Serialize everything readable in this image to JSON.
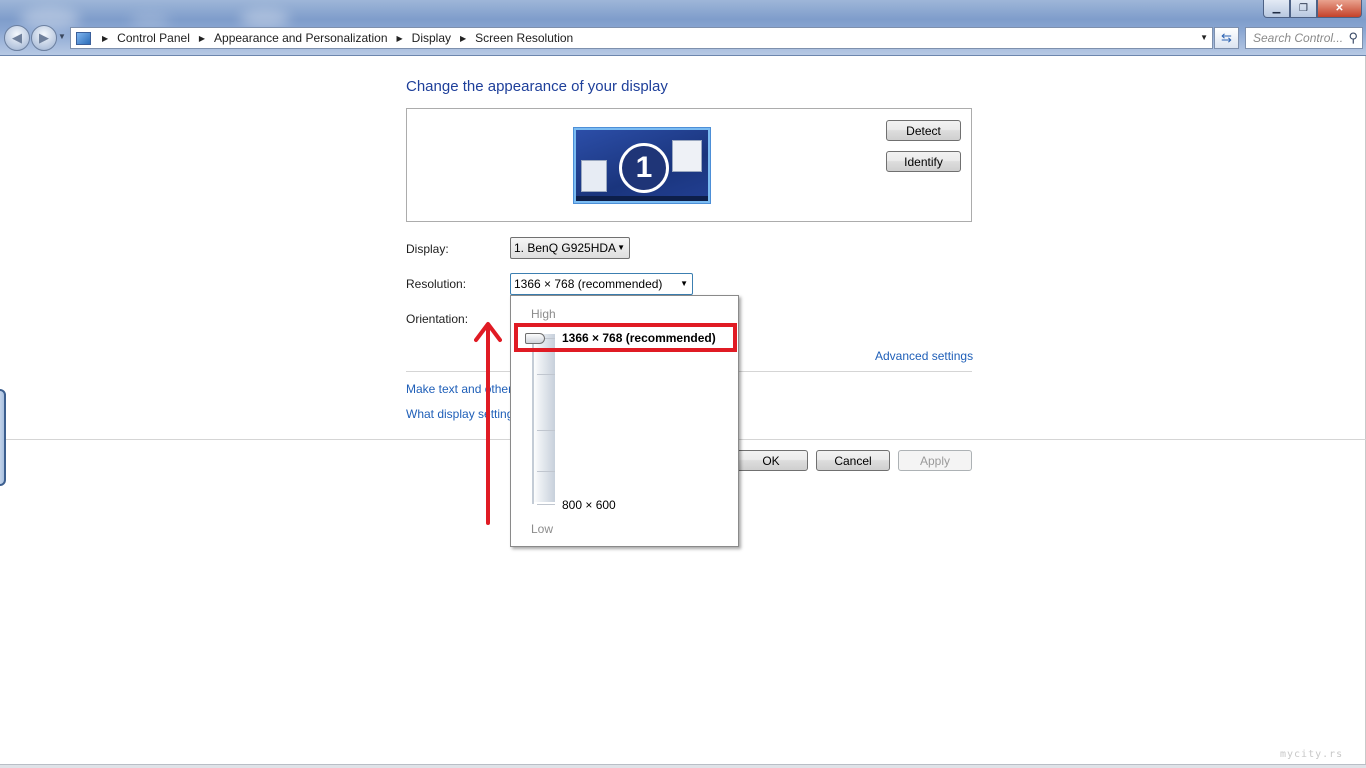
{
  "window": {
    "minimize_icon": "minimize-icon",
    "maximize_icon": "restore-icon",
    "close_icon": "close-icon"
  },
  "navigation": {
    "back_icon": "back-arrow-icon",
    "forward_icon": "forward-arrow-icon"
  },
  "address_bar": {
    "breadcrumbs": [
      "Control Panel",
      "Appearance and Personalization",
      "Display",
      "Screen Resolution"
    ]
  },
  "search": {
    "placeholder": "Search Control..."
  },
  "main": {
    "title": "Change the appearance of your display",
    "monitor_number": "1",
    "detect_label": "Detect",
    "identify_label": "Identify",
    "display_label": "Display:",
    "display_value": "1. BenQ G925HDA",
    "resolution_label": "Resolution:",
    "resolution_value": "1366 × 768 (recommended)",
    "orientation_label": "Orientation:",
    "advanced_settings_link": "Advanced settings",
    "link_text_size": "Make text and other",
    "link_display_settings": "What display setting",
    "ok_label": "OK",
    "cancel_label": "Cancel",
    "apply_label": "Apply"
  },
  "resolution_dropdown": {
    "high_label": "High",
    "low_label": "Low",
    "selected_option": "1366 × 768 (recommended)",
    "lowest_option": "800 × 600",
    "slider_level": 1.0
  },
  "annotation": {
    "highlight_color": "#e01b24",
    "arrow_color": "#e01b24"
  },
  "watermark": "mycity.rs"
}
